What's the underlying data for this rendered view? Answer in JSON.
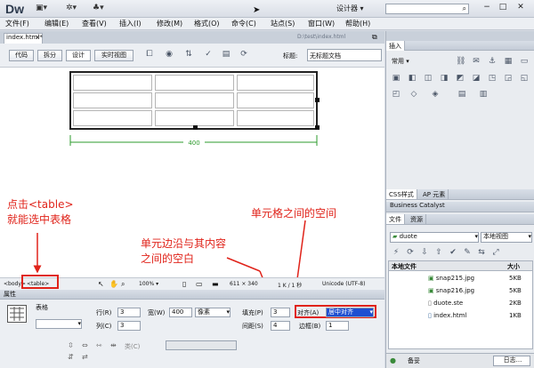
{
  "app": {
    "logo": "Dw",
    "workspace": "设计器",
    "window_controls": [
      "−",
      "□",
      "✕"
    ]
  },
  "menus": [
    "文件(F)",
    "编辑(E)",
    "查看(V)",
    "插入(I)",
    "修改(M)",
    "格式(O)",
    "命令(C)",
    "站点(S)",
    "窗口(W)",
    "帮助(H)"
  ],
  "document": {
    "tab": "index.html*",
    "path": "D:\\test\\index.html",
    "view_buttons": [
      "代码",
      "拆分",
      "设计",
      "实时视图"
    ],
    "title_label": "标题:",
    "title_value": "无标题文档",
    "table_width_label": "400"
  },
  "annotations": {
    "select_table": "点击<table>\n就能选中表格",
    "padding": "单元边沿与其内容\n之间的空白",
    "spacing": "单元格之间的空间"
  },
  "statusbar": {
    "tags": [
      "<body>",
      "<table>"
    ],
    "zoom": "100%",
    "dimensions": "611 × 340",
    "filesize": "1 K / 1 秒",
    "encoding": "Unicode (UTF-8)"
  },
  "properties": {
    "panel_title": "属性",
    "element": "表格",
    "rows_label": "行(R)",
    "rows": "3",
    "cols_label": "列(C)",
    "cols": "3",
    "width_label": "宽(W)",
    "width": "400",
    "width_unit": "像素",
    "padding_label": "填充(P)",
    "padding": "3",
    "spacing_label": "间距(S)",
    "spacing": "4",
    "align_label": "对齐(A)",
    "align": "居中对齐",
    "border_label": "边框(B)",
    "border": "1",
    "class_label": "类(C)"
  },
  "right_panel": {
    "insert_tab": "插入",
    "insert_category": "常用",
    "css_tabs": [
      "CSS样式",
      "AP 元素"
    ],
    "business_catalyst": "Business Catalyst",
    "files_tabs": [
      "文件",
      "资源"
    ],
    "site": "duote",
    "view": "本地视图",
    "col_local": "本地文件",
    "col_size": "大小",
    "files": [
      {
        "name": "snap215.jpg",
        "size": "5KB"
      },
      {
        "name": "snap216.jpg",
        "size": "5KB"
      },
      {
        "name": "duote.ste",
        "size": "2KB"
      },
      {
        "name": "index.html",
        "size": "1KB"
      }
    ],
    "bottom_label": "备妥",
    "log_button": "日志..."
  },
  "colors": {
    "annotation": "#e0231a",
    "align_highlight": "#1f4fd1",
    "guide": "#2e9b2e"
  }
}
